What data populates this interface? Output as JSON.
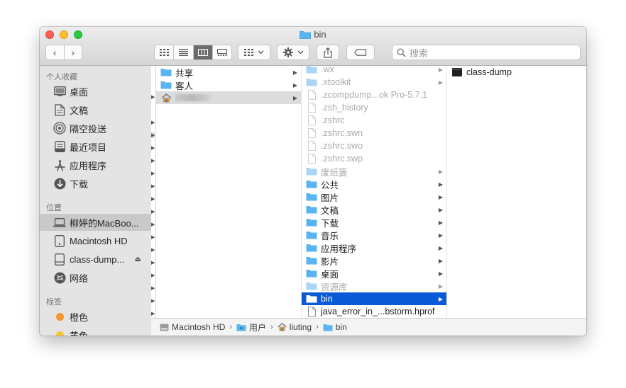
{
  "window": {
    "title": "bin"
  },
  "toolbar": {
    "back": "‹",
    "forward": "›",
    "search_placeholder": "搜索"
  },
  "sidebar": {
    "sections": [
      {
        "heading": "个人收藏",
        "items": [
          {
            "label": "桌面",
            "icon": "desktop-icon"
          },
          {
            "label": "文稿",
            "icon": "documents-icon"
          },
          {
            "label": "隔空投送",
            "icon": "airdrop-icon"
          },
          {
            "label": "最近项目",
            "icon": "recents-icon"
          },
          {
            "label": "应用程序",
            "icon": "applications-icon"
          },
          {
            "label": "下载",
            "icon": "downloads-icon"
          }
        ]
      },
      {
        "heading": "位置",
        "items": [
          {
            "label": "柳婷的MacBoo...",
            "icon": "laptop-icon"
          },
          {
            "label": "Macintosh HD",
            "icon": "disk-icon"
          },
          {
            "label": "class-dump...",
            "icon": "disk-icon"
          },
          {
            "label": "网络",
            "icon": "network-icon"
          }
        ]
      },
      {
        "heading": "标签",
        "items": [
          {
            "label": "橙色",
            "color": "#f7962c"
          },
          {
            "label": "黄色",
            "color": "#f6c62e"
          }
        ]
      }
    ]
  },
  "column1": [
    {
      "label": "共享",
      "type": "folder"
    },
    {
      "label": "客人",
      "type": "folder"
    },
    {
      "label": "",
      "type": "home",
      "blurred": true
    }
  ],
  "column2": [
    {
      "label": ".wx",
      "type": "folder",
      "dim": true,
      "arrow": true
    },
    {
      "label": ".xtoolkit",
      "type": "folder",
      "dim": true,
      "arrow": true
    },
    {
      "label": ".zcompdump...ok Pro-5.7.1",
      "type": "file",
      "dim": true
    },
    {
      "label": ".zsh_history",
      "type": "file",
      "dim": true
    },
    {
      "label": ".zshrc",
      "type": "file",
      "dim": true
    },
    {
      "label": ".zshrc.swn",
      "type": "file",
      "dim": true
    },
    {
      "label": ".zshrc.swo",
      "type": "file",
      "dim": true
    },
    {
      "label": ".zshrc.swp",
      "type": "file",
      "dim": true
    },
    {
      "label": "废纸篓",
      "type": "folder",
      "dim": true,
      "arrow": true
    },
    {
      "label": "公共",
      "type": "folder",
      "arrow": true
    },
    {
      "label": "图片",
      "type": "folder",
      "arrow": true
    },
    {
      "label": "文稿",
      "type": "folder",
      "arrow": true
    },
    {
      "label": "下载",
      "type": "folder",
      "arrow": true
    },
    {
      "label": "音乐",
      "type": "folder",
      "arrow": true
    },
    {
      "label": "应用程序",
      "type": "folder",
      "arrow": true
    },
    {
      "label": "影片",
      "type": "folder",
      "arrow": true
    },
    {
      "label": "桌面",
      "type": "folder",
      "arrow": true
    },
    {
      "label": "资源库",
      "type": "folder",
      "dim": true,
      "arrow": true
    },
    {
      "label": "bin",
      "type": "folder",
      "selected": true,
      "arrow": true
    },
    {
      "label": "java_error_in_...bstorm.hprof",
      "type": "file"
    }
  ],
  "column3": [
    {
      "label": "class-dump",
      "type": "exec"
    }
  ],
  "pathbar": [
    {
      "label": "Macintosh HD",
      "icon": "disk-icon"
    },
    {
      "label": "用户",
      "icon": "folder-icon"
    },
    {
      "label": "liuting",
      "icon": "home-icon"
    },
    {
      "label": "bin",
      "icon": "folder-icon"
    }
  ],
  "colors": {
    "accent": "#0a59d7",
    "folder": "#5ab4f1"
  }
}
